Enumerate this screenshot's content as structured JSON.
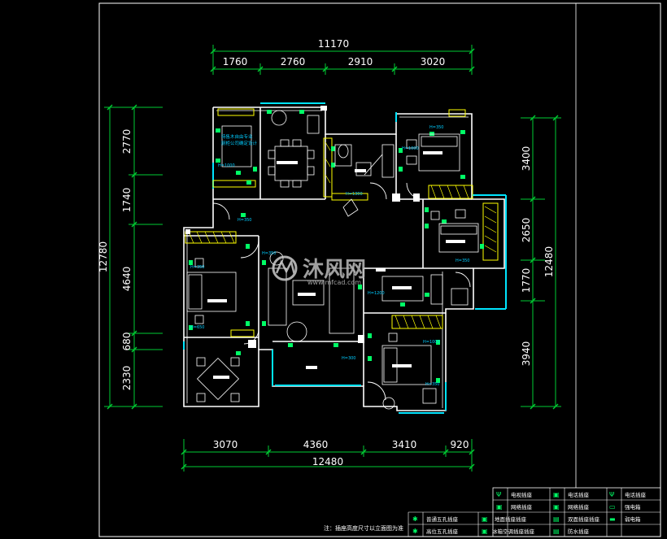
{
  "dims": {
    "top_total": "11170",
    "top_segments": [
      "1760",
      "2760",
      "2910",
      "3020"
    ],
    "bottom_total": "12480",
    "bottom_segments": [
      "3070",
      "4360",
      "3410",
      "920"
    ],
    "left_total": "12780",
    "left_segments": [
      "2770",
      "1740",
      "4640",
      "680",
      "2330"
    ],
    "right_total": "12480",
    "right_segments": [
      "3400",
      "2650",
      "1770",
      "3940"
    ]
  },
  "annotations": {
    "room_note_line1": "待售木自由专业",
    "room_note_line2": "厨柜公司确定设计",
    "heights": [
      "H=350",
      "H=1000",
      "H=1300",
      "H=650",
      "H=1200",
      "H=300"
    ]
  },
  "watermark": {
    "brand": "沐风网",
    "url": "www.mfcad.com"
  },
  "footer_note": "注：插座高度尺寸以立面图为准",
  "legend": {
    "rows": [
      [
        "电视插座",
        "电话插座",
        "电话插座"
      ],
      [
        "网络插座",
        "网络插座",
        "强电箱"
      ],
      [
        "地面插座插座",
        "双面插座插座",
        "弱电箱"
      ],
      [
        "防水插座",
        "冰箱空调插座插座",
        "防水插座"
      ]
    ],
    "side_labels": [
      "普通五孔插座",
      "高位五孔插座"
    ]
  },
  "colors": {
    "background": "#000000",
    "wall": "#ffffff",
    "dimension": "#00cc33",
    "furniture": "#ffffff",
    "accent_cyan": "#00e5ff",
    "accent_yellow": "#ffff00",
    "accent_green": "#00ff66"
  }
}
